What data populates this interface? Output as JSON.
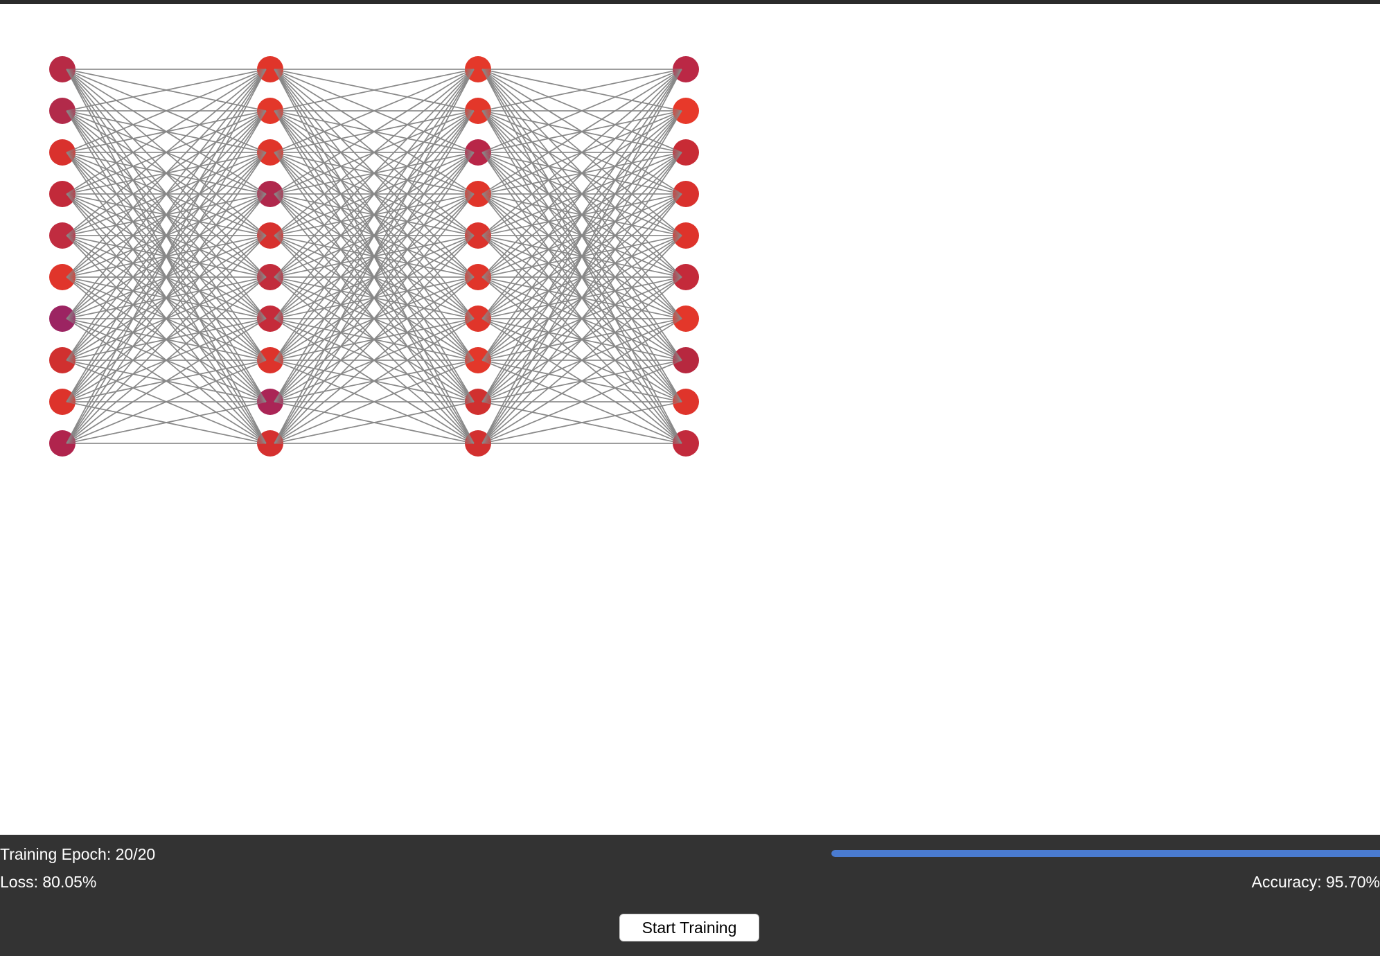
{
  "network": {
    "layers": [
      {
        "name": "layer-1",
        "neuron_colors": [
          "#b72a45",
          "#b22a4a",
          "#d9312d",
          "#c22a3a",
          "#c02c40",
          "#e0352b",
          "#9c2462",
          "#d0302f",
          "#dd332b",
          "#b0244d"
        ]
      },
      {
        "name": "layer-2",
        "neuron_colors": [
          "#e0352a",
          "#e3372a",
          "#e0352a",
          "#b0284c",
          "#d7312e",
          "#c22c3c",
          "#c52b3a",
          "#dd332b",
          "#aa2556",
          "#d5302f"
        ]
      },
      {
        "name": "layer-3",
        "neuron_colors": [
          "#e4382a",
          "#e3372a",
          "#b82648",
          "#e0352a",
          "#dc332c",
          "#e0352a",
          "#e0352a",
          "#e3372a",
          "#d0302f",
          "#d2302f"
        ]
      },
      {
        "name": "layer-4",
        "neuron_colors": [
          "#bb2845",
          "#e7392a",
          "#c82b35",
          "#d9312d",
          "#de332b",
          "#c42a3a",
          "#e3372a",
          "#b7283f",
          "#df342b",
          "#c22a3c"
        ]
      }
    ],
    "connection_color": "#888888"
  },
  "status": {
    "epoch_text": "Training Epoch: 20/20",
    "loss_text": "Loss: 80.05%",
    "accuracy_text": "Accuracy: 95.70%",
    "progress_fraction": 1.0,
    "progress_color": "#4a7bd0"
  },
  "controls": {
    "start_label": "Start Training"
  }
}
